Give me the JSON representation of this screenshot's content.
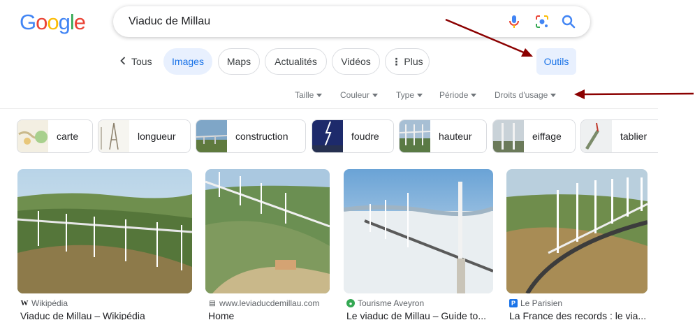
{
  "logo": {
    "letters": [
      "G",
      "o",
      "o",
      "g",
      "l",
      "e"
    ],
    "colors": [
      "#4285f4",
      "#ea4335",
      "#fbbc05",
      "#4285f4",
      "#34a853",
      "#ea4335"
    ]
  },
  "search": {
    "value": "Viaduc de Millau",
    "icons": [
      "mic-icon",
      "lens-icon",
      "search-icon"
    ]
  },
  "nav": {
    "back_label": "Tous",
    "tabs": [
      "Images",
      "Maps",
      "Actualités",
      "Vidéos",
      "Plus"
    ],
    "active_tab": "Images",
    "tools_label": "Outils"
  },
  "filters": [
    "Taille",
    "Couleur",
    "Type",
    "Période",
    "Droits d'usage"
  ],
  "related": [
    "carte",
    "longueur",
    "construction",
    "foudre",
    "hauteur",
    "eiffage",
    "tablier"
  ],
  "results": [
    {
      "source": "Wikipédia",
      "title": "Viaduc de Millau – Wikipédia"
    },
    {
      "source": "www.leviaducdemillau.com",
      "title": "Home"
    },
    {
      "source": "Tourisme Aveyron",
      "title": "Le viaduc de Millau – Guide to..."
    },
    {
      "source": "Le Parisien",
      "title": "La France des records : le via..."
    }
  ],
  "annotation_color": "#8b0000"
}
